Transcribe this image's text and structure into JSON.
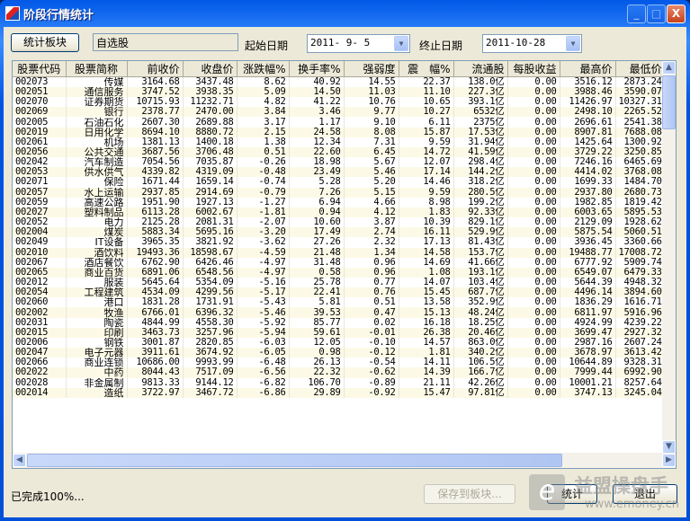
{
  "window": {
    "title": "阶段行情统计",
    "minimize": "_",
    "maximize": "□",
    "close": "X"
  },
  "toolbar": {
    "block_button": "统计板块",
    "block_value": "自选股",
    "start_label": "起始日期",
    "start_value": "2011- 9- 5",
    "end_label": "终止日期",
    "end_value": "2011-10-28"
  },
  "table": {
    "columns": [
      "股票代码",
      "股票简称",
      "前收价",
      "收盘价",
      "涨跌幅%",
      "换手率%",
      "强弱度",
      "震　幅%",
      "流通股",
      "每股收益",
      "最高价",
      "最低价"
    ],
    "rows": [
      [
        "002073",
        "传媒",
        "3164.68",
        "3437.48",
        "8.62",
        "40.92",
        "14.55",
        "22.37",
        "138.0亿",
        "0.00",
        "3516.12",
        "2873.24"
      ],
      [
        "002051",
        "通信服务",
        "3747.52",
        "3938.35",
        "5.09",
        "14.50",
        "11.03",
        "11.10",
        "227.3亿",
        "0.00",
        "3988.46",
        "3590.07"
      ],
      [
        "002070",
        "证券期货",
        "10715.93",
        "11232.71",
        "4.82",
        "41.22",
        "10.76",
        "10.65",
        "393.1亿",
        "0.00",
        "11426.97",
        "10327.31"
      ],
      [
        "002069",
        "银行",
        "2378.77",
        "2470.00",
        "3.84",
        "3.46",
        "9.77",
        "10.27",
        "6532亿",
        "0.00",
        "2498.10",
        "2265.52"
      ],
      [
        "002005",
        "石油石化",
        "2607.30",
        "2689.88",
        "3.17",
        "1.17",
        "9.10",
        "6.11",
        "2375亿",
        "0.00",
        "2696.61",
        "2541.38"
      ],
      [
        "002019",
        "日用化学",
        "8694.10",
        "8880.72",
        "2.15",
        "24.58",
        "8.08",
        "15.87",
        "17.53亿",
        "0.00",
        "8907.81",
        "7688.08"
      ],
      [
        "002061",
        "机场",
        "1381.13",
        "1400.18",
        "1.38",
        "12.34",
        "7.31",
        "9.59",
        "31.94亿",
        "0.00",
        "1425.64",
        "1300.92"
      ],
      [
        "002056",
        "公共交通",
        "3687.56",
        "3706.48",
        "0.51",
        "22.60",
        "6.45",
        "14.72",
        "41.59亿",
        "0.00",
        "3729.22",
        "3250.85"
      ],
      [
        "002042",
        "汽车制造",
        "7054.56",
        "7035.87",
        "-0.26",
        "18.98",
        "5.67",
        "12.07",
        "298.4亿",
        "0.00",
        "7246.16",
        "6465.69"
      ],
      [
        "002053",
        "供水供气",
        "4339.82",
        "4319.09",
        "-0.48",
        "23.49",
        "5.46",
        "17.14",
        "144.2亿",
        "0.00",
        "4414.02",
        "3768.08"
      ],
      [
        "002071",
        "保险",
        "1671.44",
        "1659.14",
        "-0.74",
        "5.28",
        "5.20",
        "14.46",
        "318.2亿",
        "0.00",
        "1699.33",
        "1484.70"
      ],
      [
        "002057",
        "水上运输",
        "2937.85",
        "2914.69",
        "-0.79",
        "7.26",
        "5.15",
        "9.59",
        "280.5亿",
        "0.00",
        "2937.80",
        "2680.73"
      ],
      [
        "002059",
        "高速公路",
        "1951.90",
        "1927.13",
        "-1.27",
        "6.94",
        "4.66",
        "8.98",
        "199.2亿",
        "0.00",
        "1982.85",
        "1819.42"
      ],
      [
        "002027",
        "塑料制品",
        "6113.28",
        "6002.67",
        "-1.81",
        "0.94",
        "4.12",
        "1.83",
        "92.33亿",
        "0.00",
        "6003.65",
        "5895.53"
      ],
      [
        "002052",
        "电力",
        "2125.28",
        "2081.31",
        "-2.07",
        "10.60",
        "3.87",
        "10.39",
        "829.1亿",
        "0.00",
        "2129.09",
        "1928.62"
      ],
      [
        "002004",
        "煤炭",
        "5883.34",
        "5695.16",
        "-3.20",
        "17.49",
        "2.74",
        "16.11",
        "529.9亿",
        "0.00",
        "5875.54",
        "5060.51"
      ],
      [
        "002049",
        "IT设备",
        "3965.35",
        "3821.92",
        "-3.62",
        "27.26",
        "2.32",
        "17.13",
        "81.43亿",
        "0.00",
        "3936.45",
        "3360.66"
      ],
      [
        "002010",
        "酒饮料",
        "19493.36",
        "18598.67",
        "-4.59",
        "21.48",
        "1.34",
        "14.58",
        "153.7亿",
        "0.00",
        "19488.77",
        "17008.72"
      ],
      [
        "002067",
        "酒店餐饮",
        "6762.90",
        "6426.46",
        "-4.97",
        "31.48",
        "0.96",
        "14.69",
        "41.66亿",
        "0.00",
        "6777.92",
        "5909.74"
      ],
      [
        "002065",
        "商业百货",
        "6891.06",
        "6548.56",
        "-4.97",
        "0.58",
        "0.96",
        "1.08",
        "193.1亿",
        "0.00",
        "6549.07",
        "6479.33"
      ],
      [
        "002012",
        "服装",
        "5645.64",
        "5354.09",
        "-5.16",
        "25.78",
        "0.77",
        "14.07",
        "103.4亿",
        "0.00",
        "5644.39",
        "4948.32"
      ],
      [
        "002054",
        "工程建筑",
        "4534.09",
        "4299.56",
        "-5.17",
        "22.41",
        "0.76",
        "15.45",
        "687.7亿",
        "0.00",
        "4496.14",
        "3894.60"
      ],
      [
        "002060",
        "港口",
        "1831.28",
        "1731.91",
        "-5.43",
        "5.81",
        "0.51",
        "13.58",
        "352.9亿",
        "0.00",
        "1836.29",
        "1616.71"
      ],
      [
        "002002",
        "牧渔",
        "6766.01",
        "6396.32",
        "-5.46",
        "39.53",
        "0.47",
        "15.13",
        "48.24亿",
        "0.00",
        "6811.97",
        "5916.96"
      ],
      [
        "002031",
        "陶瓷",
        "4844.99",
        "4558.30",
        "-5.92",
        "85.77",
        "0.02",
        "16.18",
        "18.25亿",
        "0.00",
        "4924.99",
        "4239.22"
      ],
      [
        "002015",
        "印刷",
        "3463.73",
        "3257.96",
        "-5.94",
        "59.61",
        "-0.01",
        "26.38",
        "20.46亿",
        "0.00",
        "3699.47",
        "2927.32"
      ],
      [
        "002006",
        "钢铁",
        "3001.87",
        "2820.85",
        "-6.03",
        "12.05",
        "-0.10",
        "14.57",
        "863.0亿",
        "0.00",
        "2987.16",
        "2607.24"
      ],
      [
        "002047",
        "电子元器",
        "3911.61",
        "3674.92",
        "-6.05",
        "0.98",
        "-0.12",
        "1.81",
        "340.2亿",
        "0.00",
        "3678.97",
        "3613.42"
      ],
      [
        "002066",
        "商业连锁",
        "10686.00",
        "9993.99",
        "-6.48",
        "26.13",
        "-0.54",
        "14.11",
        "106.5亿",
        "0.00",
        "10644.89",
        "9328.31"
      ],
      [
        "002022",
        "中药",
        "8044.43",
        "7517.09",
        "-6.56",
        "22.32",
        "-0.62",
        "14.39",
        "166.7亿",
        "0.00",
        "7999.44",
        "6992.90"
      ],
      [
        "002028",
        "非金属制",
        "9813.33",
        "9144.12",
        "-6.82",
        "106.70",
        "-0.89",
        "21.11",
        "42.26亿",
        "0.00",
        "10001.21",
        "8257.64"
      ],
      [
        "002014",
        "造纸",
        "3722.97",
        "3467.72",
        "-6.86",
        "29.89",
        "-0.92",
        "15.47",
        "97.81亿",
        "0.00",
        "3747.13",
        "3245.04"
      ]
    ]
  },
  "status": {
    "text": "已完成100%..."
  },
  "buttons": {
    "save": "保存到板块...",
    "stat": "统计",
    "exit": "退出"
  },
  "watermark": {
    "brand": "益盟操盘手",
    "url": "www.emoney.cn"
  },
  "colors": {
    "titlebar": "#0054e3",
    "face": "#ece9d8",
    "row_alt": "#fcfae6"
  }
}
